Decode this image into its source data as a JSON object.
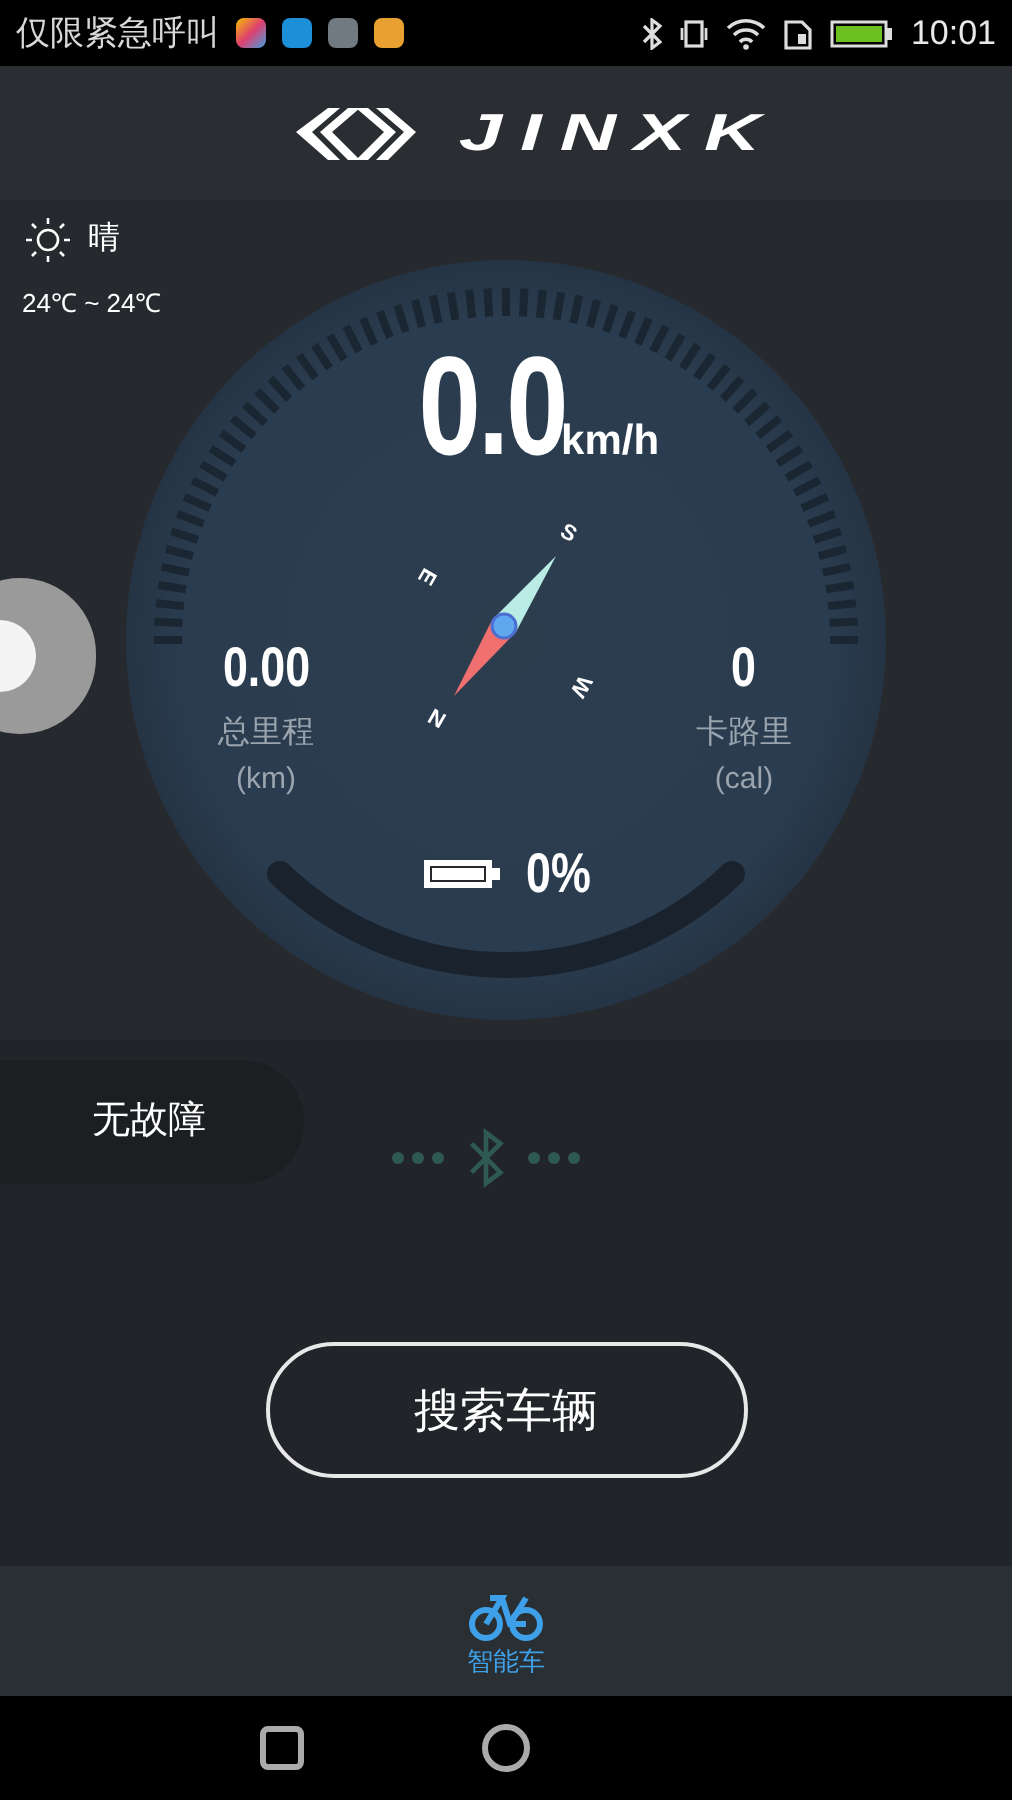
{
  "status_bar": {
    "carrier": "仅限紧急呼叫",
    "time": "10:01"
  },
  "header": {
    "logo": "JINXK"
  },
  "weather": {
    "condition": "晴",
    "range": "24℃ ~ 24℃"
  },
  "gauge": {
    "speed": "0.0",
    "speed_unit": "km/h",
    "compass": [
      "S",
      "E",
      "W",
      "N"
    ],
    "mileage": {
      "value": "0.00",
      "label": "总里程",
      "unit": "(km)"
    },
    "calories": {
      "value": "0",
      "label": "卡路里",
      "unit": "(cal)"
    },
    "battery": "0%"
  },
  "fault_status": "无故障",
  "search_button": "搜索车辆",
  "tabs": [
    {
      "label": "智能车",
      "selected": true
    }
  ]
}
